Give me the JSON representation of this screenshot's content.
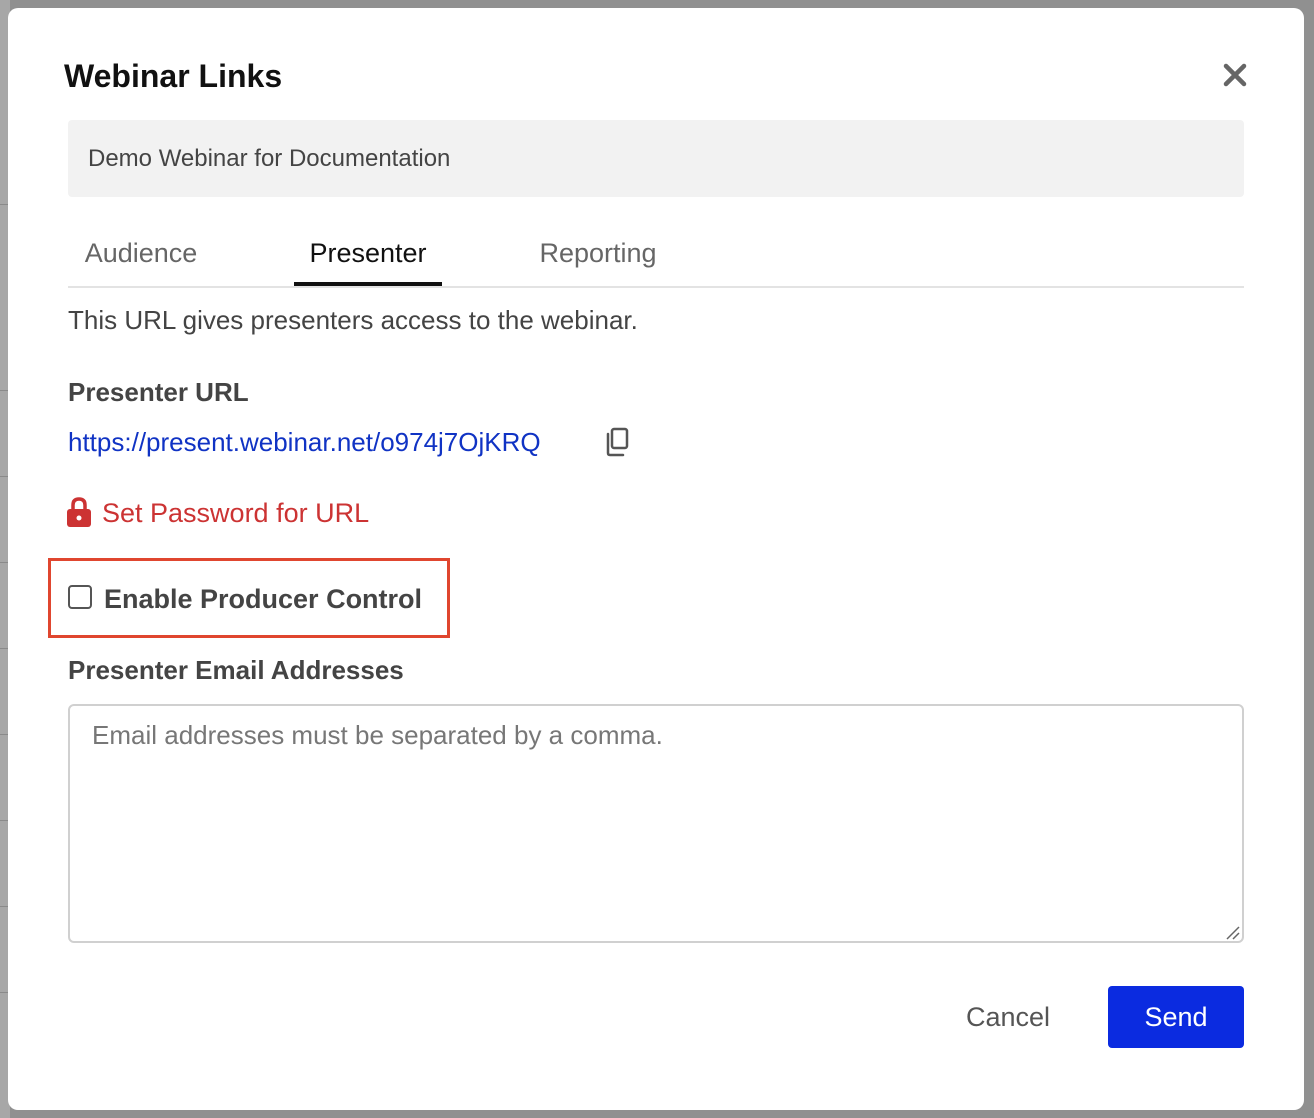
{
  "dialog": {
    "title": "Webinar Links",
    "webinar_name": "Demo Webinar for Documentation"
  },
  "tabs": [
    {
      "label": "Audience",
      "active": false
    },
    {
      "label": "Presenter",
      "active": true
    },
    {
      "label": "Reporting",
      "active": false
    }
  ],
  "presenter": {
    "description": "This URL gives presenters access to the webinar.",
    "url_label": "Presenter URL",
    "url": "https://present.webinar.net/o974j7OjKRQ",
    "set_password_label": "Set Password for URL",
    "producer_control_label": "Enable Producer Control",
    "producer_control_checked": false,
    "emails_label": "Presenter Email Addresses",
    "emails_value": "",
    "emails_placeholder": "Email addresses must be separated by a comma."
  },
  "footer": {
    "cancel_label": "Cancel",
    "send_label": "Send"
  },
  "icons": {
    "close": "close-icon",
    "copy": "copy-icon",
    "lock": "lock-icon"
  },
  "colors": {
    "link": "#1033c4",
    "password_link": "#cc3333",
    "primary_button": "#0b2be0",
    "highlight_box": "#e0462f"
  }
}
